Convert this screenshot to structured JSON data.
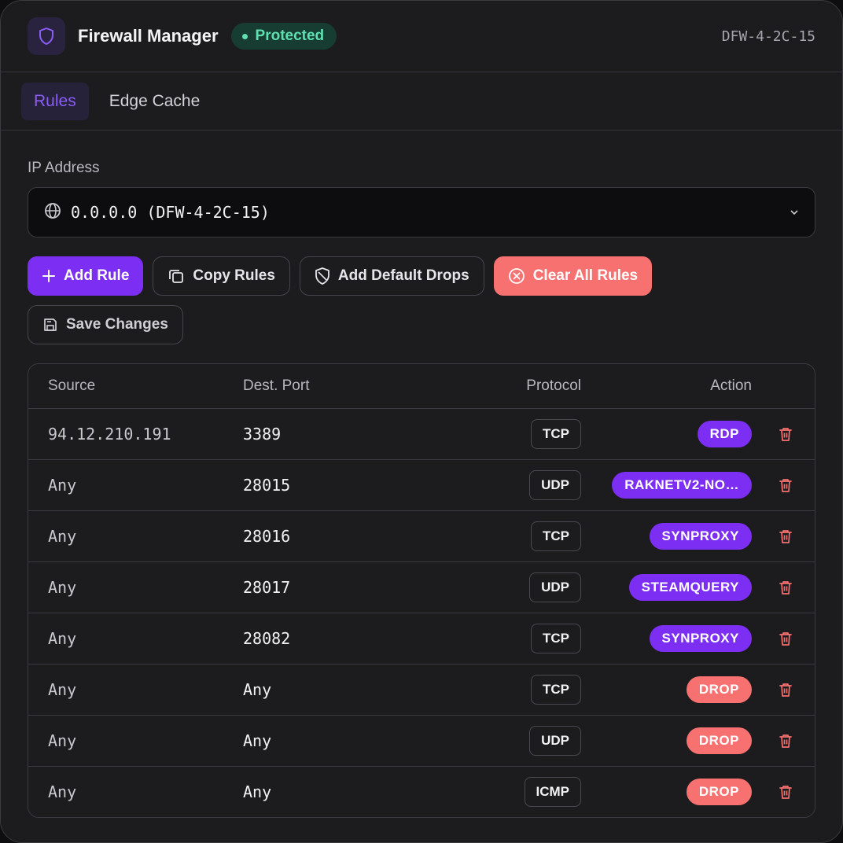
{
  "header": {
    "title": "Firewall Manager",
    "status": "Protected",
    "host_id": "DFW-4-2C-15",
    "icon": "shield-icon"
  },
  "tabs": [
    {
      "label": "Rules",
      "active": true
    },
    {
      "label": "Edge Cache",
      "active": false
    }
  ],
  "ip_select": {
    "label": "IP Address",
    "value": "0.0.0.0 (DFW-4-2C-15)"
  },
  "toolbar": {
    "add_rule": "Add Rule",
    "copy_rules": "Copy Rules",
    "add_default_drops": "Add Default Drops",
    "clear_all_rules": "Clear All Rules",
    "save_changes": "Save Changes"
  },
  "table": {
    "columns": [
      "Source",
      "Dest. Port",
      "Protocol",
      "Action"
    ],
    "rows": [
      {
        "source": "94.12.210.191",
        "port": "3389",
        "protocol": "TCP",
        "action": "RDP",
        "action_color": "#7c2ff2"
      },
      {
        "source": "Any",
        "port": "28015",
        "protocol": "UDP",
        "action": "RAKNETV2-NO…",
        "action_color": "#7c2ff2"
      },
      {
        "source": "Any",
        "port": "28016",
        "protocol": "TCP",
        "action": "SYNPROXY",
        "action_color": "#7c2ff2"
      },
      {
        "source": "Any",
        "port": "28017",
        "protocol": "UDP",
        "action": "STEAMQUERY",
        "action_color": "#7c2ff2"
      },
      {
        "source": "Any",
        "port": "28082",
        "protocol": "TCP",
        "action": "SYNPROXY",
        "action_color": "#7c2ff2"
      },
      {
        "source": "Any",
        "port": "Any",
        "protocol": "TCP",
        "action": "DROP",
        "action_color": "#f87171"
      },
      {
        "source": "Any",
        "port": "Any",
        "protocol": "UDP",
        "action": "DROP",
        "action_color": "#f87171"
      },
      {
        "source": "Any",
        "port": "Any",
        "protocol": "ICMP",
        "action": "DROP",
        "action_color": "#f87171"
      }
    ]
  },
  "colors": {
    "accent": "#7c2ff2",
    "danger": "#f87171",
    "success": "#5ee0b0"
  }
}
